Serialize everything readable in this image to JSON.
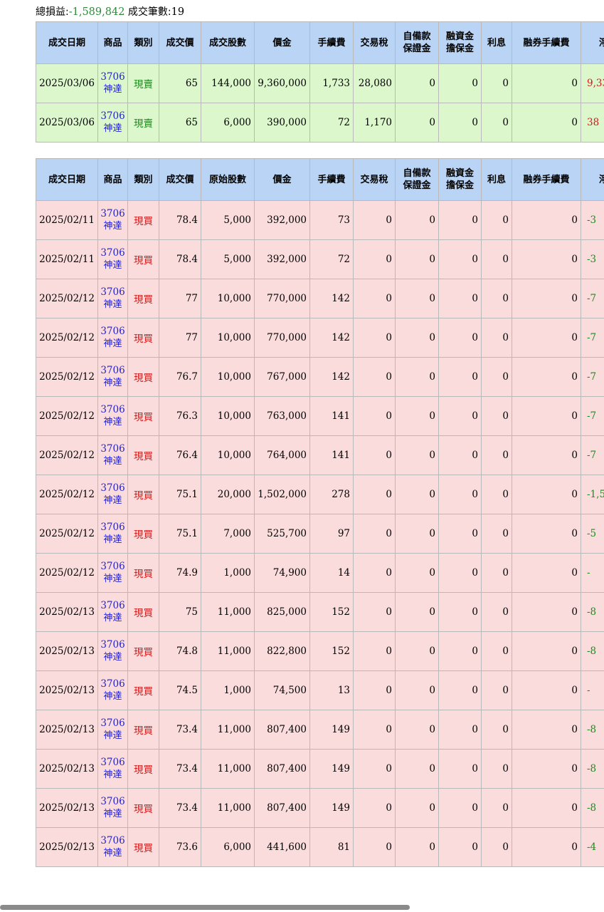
{
  "summary": {
    "pl_label": "總損益:",
    "pl_value": "-1,589,842",
    "count_label": " 成交筆數:",
    "count_value": "19"
  },
  "sell_table": {
    "headers": [
      "成交日期",
      "商品",
      "類別",
      "成交價",
      "成交股數",
      "價金",
      "手續費",
      "交易稅",
      "自備款\n保證金",
      "融資金\n擔保金",
      "利息",
      "融券手續費",
      "淨"
    ],
    "rows": [
      {
        "date": "2025/03/06",
        "code": "3706",
        "name": "神達",
        "type": "現賣",
        "price": "65",
        "shares": "144,000",
        "amount": "9,360,000",
        "fee": "1,733",
        "tax": "28,080",
        "margin": "0",
        "loan": "0",
        "interest": "0",
        "short_fee": "0",
        "net": "9,33"
      },
      {
        "date": "2025/03/06",
        "code": "3706",
        "name": "神達",
        "type": "現賣",
        "price": "65",
        "shares": "6,000",
        "amount": "390,000",
        "fee": "72",
        "tax": "1,170",
        "margin": "0",
        "loan": "0",
        "interest": "0",
        "short_fee": "0",
        "net": "38"
      }
    ]
  },
  "buy_table": {
    "headers": [
      "成交日期",
      "商品",
      "類別",
      "成交價",
      "原始股數",
      "價金",
      "手續費",
      "交易稅",
      "自備款\n保證金",
      "融資金\n擔保金",
      "利息",
      "融券手續費",
      "淨"
    ],
    "rows": [
      {
        "date": "2025/02/11",
        "code": "3706",
        "name": "神達",
        "type": "現買",
        "price": "78.4",
        "shares": "5,000",
        "amount": "392,000",
        "fee": "73",
        "tax": "0",
        "margin": "0",
        "loan": "0",
        "interest": "0",
        "short_fee": "0",
        "net": "-3"
      },
      {
        "date": "2025/02/11",
        "code": "3706",
        "name": "神達",
        "type": "現買",
        "price": "78.4",
        "shares": "5,000",
        "amount": "392,000",
        "fee": "72",
        "tax": "0",
        "margin": "0",
        "loan": "0",
        "interest": "0",
        "short_fee": "0",
        "net": "-3"
      },
      {
        "date": "2025/02/12",
        "code": "3706",
        "name": "神達",
        "type": "現買",
        "price": "77",
        "shares": "10,000",
        "amount": "770,000",
        "fee": "142",
        "tax": "0",
        "margin": "0",
        "loan": "0",
        "interest": "0",
        "short_fee": "0",
        "net": "-7"
      },
      {
        "date": "2025/02/12",
        "code": "3706",
        "name": "神達",
        "type": "現買",
        "price": "77",
        "shares": "10,000",
        "amount": "770,000",
        "fee": "142",
        "tax": "0",
        "margin": "0",
        "loan": "0",
        "interest": "0",
        "short_fee": "0",
        "net": "-7"
      },
      {
        "date": "2025/02/12",
        "code": "3706",
        "name": "神達",
        "type": "現買",
        "price": "76.7",
        "shares": "10,000",
        "amount": "767,000",
        "fee": "142",
        "tax": "0",
        "margin": "0",
        "loan": "0",
        "interest": "0",
        "short_fee": "0",
        "net": "-7"
      },
      {
        "date": "2025/02/12",
        "code": "3706",
        "name": "神達",
        "type": "現買",
        "price": "76.3",
        "shares": "10,000",
        "amount": "763,000",
        "fee": "141",
        "tax": "0",
        "margin": "0",
        "loan": "0",
        "interest": "0",
        "short_fee": "0",
        "net": "-7"
      },
      {
        "date": "2025/02/12",
        "code": "3706",
        "name": "神達",
        "type": "現買",
        "price": "76.4",
        "shares": "10,000",
        "amount": "764,000",
        "fee": "141",
        "tax": "0",
        "margin": "0",
        "loan": "0",
        "interest": "0",
        "short_fee": "0",
        "net": "-7"
      },
      {
        "date": "2025/02/12",
        "code": "3706",
        "name": "神達",
        "type": "現買",
        "price": "75.1",
        "shares": "20,000",
        "amount": "1,502,000",
        "fee": "278",
        "tax": "0",
        "margin": "0",
        "loan": "0",
        "interest": "0",
        "short_fee": "0",
        "net": "-1,5"
      },
      {
        "date": "2025/02/12",
        "code": "3706",
        "name": "神達",
        "type": "現買",
        "price": "75.1",
        "shares": "7,000",
        "amount": "525,700",
        "fee": "97",
        "tax": "0",
        "margin": "0",
        "loan": "0",
        "interest": "0",
        "short_fee": "0",
        "net": "-5"
      },
      {
        "date": "2025/02/12",
        "code": "3706",
        "name": "神達",
        "type": "現買",
        "price": "74.9",
        "shares": "1,000",
        "amount": "74,900",
        "fee": "14",
        "tax": "0",
        "margin": "0",
        "loan": "0",
        "interest": "0",
        "short_fee": "0",
        "net": "-"
      },
      {
        "date": "2025/02/13",
        "code": "3706",
        "name": "神達",
        "type": "現買",
        "price": "75",
        "shares": "11,000",
        "amount": "825,000",
        "fee": "152",
        "tax": "0",
        "margin": "0",
        "loan": "0",
        "interest": "0",
        "short_fee": "0",
        "net": "-8"
      },
      {
        "date": "2025/02/13",
        "code": "3706",
        "name": "神達",
        "type": "現買",
        "price": "74.8",
        "shares": "11,000",
        "amount": "822,800",
        "fee": "152",
        "tax": "0",
        "margin": "0",
        "loan": "0",
        "interest": "0",
        "short_fee": "0",
        "net": "-8"
      },
      {
        "date": "2025/02/13",
        "code": "3706",
        "name": "神達",
        "type": "現買",
        "price": "74.5",
        "shares": "1,000",
        "amount": "74,500",
        "fee": "13",
        "tax": "0",
        "margin": "0",
        "loan": "0",
        "interest": "0",
        "short_fee": "0",
        "net": "-"
      },
      {
        "date": "2025/02/13",
        "code": "3706",
        "name": "神達",
        "type": "現買",
        "price": "73.4",
        "shares": "11,000",
        "amount": "807,400",
        "fee": "149",
        "tax": "0",
        "margin": "0",
        "loan": "0",
        "interest": "0",
        "short_fee": "0",
        "net": "-8"
      },
      {
        "date": "2025/02/13",
        "code": "3706",
        "name": "神達",
        "type": "現買",
        "price": "73.4",
        "shares": "11,000",
        "amount": "807,400",
        "fee": "149",
        "tax": "0",
        "margin": "0",
        "loan": "0",
        "interest": "0",
        "short_fee": "0",
        "net": "-8"
      },
      {
        "date": "2025/02/13",
        "code": "3706",
        "name": "神達",
        "type": "現買",
        "price": "73.4",
        "shares": "11,000",
        "amount": "807,400",
        "fee": "149",
        "tax": "0",
        "margin": "0",
        "loan": "0",
        "interest": "0",
        "short_fee": "0",
        "net": "-8"
      },
      {
        "date": "2025/02/13",
        "code": "3706",
        "name": "神達",
        "type": "現買",
        "price": "73.6",
        "shares": "6,000",
        "amount": "441,600",
        "fee": "81",
        "tax": "0",
        "margin": "0",
        "loan": "0",
        "interest": "0",
        "short_fee": "0",
        "net": "-4"
      }
    ]
  },
  "colors": {
    "header_bg": "#b9d4f5",
    "sell_row_bg": "#dcf7cc",
    "buy_row_bg": "#fbdcdc",
    "product_link": "#1f1fd6",
    "sell_type": "#1e8a1e",
    "buy_type": "#d01a1a"
  }
}
